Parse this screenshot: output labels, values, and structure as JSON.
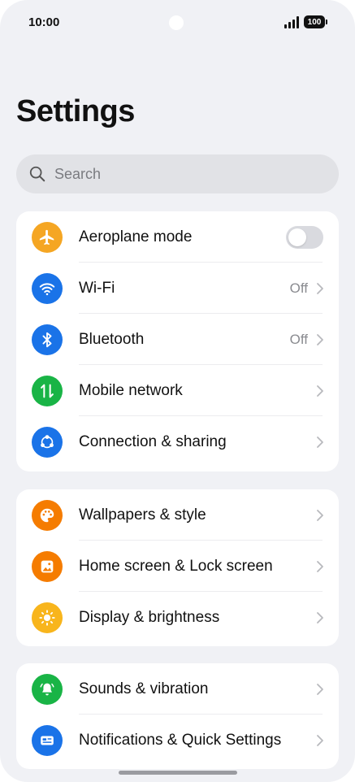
{
  "status_bar": {
    "time": "10:00",
    "battery": "100"
  },
  "title": "Settings",
  "search": {
    "placeholder": "Search"
  },
  "groups": [
    {
      "items": [
        {
          "label": "Aeroplane mode",
          "icon": "airplane-icon",
          "icon_color": "#f5a623",
          "control": "toggle",
          "toggle_on": false
        },
        {
          "label": "Wi-Fi",
          "icon": "wifi-icon",
          "icon_color": "#1a73e8",
          "value": "Off"
        },
        {
          "label": "Bluetooth",
          "icon": "bluetooth-icon",
          "icon_color": "#1a73e8",
          "value": "Off"
        },
        {
          "label": "Mobile network",
          "icon": "mobile-data-icon",
          "icon_color": "#19b446"
        },
        {
          "label": "Connection & sharing",
          "icon": "share-icon",
          "icon_color": "#1a73e8"
        }
      ]
    },
    {
      "items": [
        {
          "label": "Wallpapers & style",
          "icon": "palette-icon",
          "icon_color": "#f57c00"
        },
        {
          "label": "Home screen & Lock screen",
          "icon": "home-screen-icon",
          "icon_color": "#f57c00"
        },
        {
          "label": "Display & brightness",
          "icon": "sun-icon",
          "icon_color": "#f8b51c"
        }
      ]
    },
    {
      "items": [
        {
          "label": "Sounds & vibration",
          "icon": "bell-icon",
          "icon_color": "#19b446"
        },
        {
          "label": "Notifications & Quick Settings",
          "icon": "notification-icon",
          "icon_color": "#1a73e8"
        }
      ]
    }
  ]
}
